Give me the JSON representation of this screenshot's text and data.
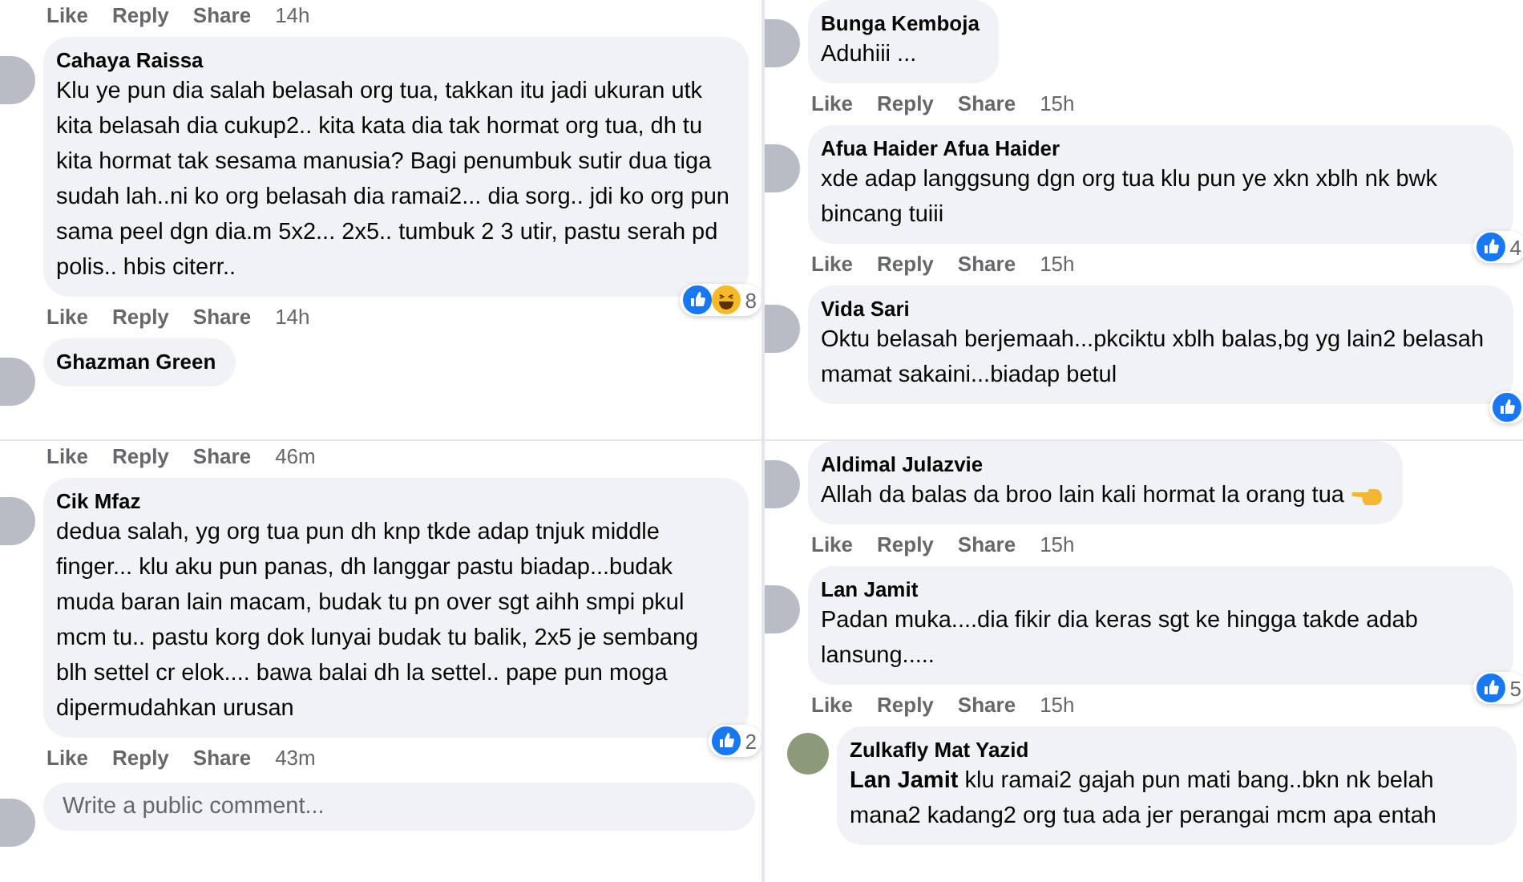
{
  "panels": [
    {
      "items": [
        {
          "kind": "actions",
          "like": "Like",
          "reply": "Reply",
          "share": "Share",
          "time": "14h"
        },
        {
          "kind": "comment",
          "name": "Cahaya Raissa",
          "text": "Klu ye pun dia salah belasah org tua, takkan itu jadi ukuran utk kita belasah dia cukup2.. kita kata dia tak hormat org tua, dh tu kita hormat tak sesama manusia? Bagi penumbuk sutir dua tiga sudah lah..ni ko org belasah dia ramai2... dia sorg.. jdi ko org pun sama peel dgn dia.m 5x2... 2x5.. tumbuk 2 3 utir, pastu serah pd polis.. hbis citerr..",
          "reactions": {
            "icons": [
              {
                "kind": "like"
              },
              {
                "kind": "haha"
              }
            ],
            "count": "8"
          }
        },
        {
          "kind": "actions",
          "like": "Like",
          "reply": "Reply",
          "share": "Share",
          "time": "14h"
        },
        {
          "kind": "comment",
          "name": "Ghazman Green"
        }
      ]
    },
    {
      "items": [
        {
          "kind": "actions",
          "like": "Like",
          "reply": "Reply",
          "share": "Share",
          "time": "46m"
        },
        {
          "kind": "comment",
          "name": "Cik Mfaz",
          "text": "dedua salah, yg org tua pun dh knp tkde adap tnjuk middle finger... klu aku pun panas, dh langgar pastu biadap...budak muda baran lain macam, budak tu pn over sgt aihh smpi pkul mcm tu.. pastu korg dok lunyai budak tu balik, 2x5 je sembang blh settel cr elok.... bawa balai dh la settel.. pape pun moga dipermudahkan urusan",
          "reactions": {
            "icons": [
              {
                "kind": "like"
              }
            ],
            "count": "2"
          }
        },
        {
          "kind": "actions",
          "like": "Like",
          "reply": "Reply",
          "share": "Share",
          "time": "43m"
        },
        {
          "kind": "composer",
          "placeholder": "Write a public comment..."
        }
      ]
    },
    {
      "items": [
        {
          "kind": "comment",
          "name": "Bunga Kemboja",
          "text": "Aduhiii ..."
        },
        {
          "kind": "actions",
          "like": "Like",
          "reply": "Reply",
          "share": "Share",
          "time": "15h"
        },
        {
          "kind": "comment",
          "name": "Afua Haider Afua Haider",
          "text": "xde adap langgsung dgn org tua klu pun ye xkn xblh nk bwk bincang tuiii",
          "reactions": {
            "icons": [
              {
                "kind": "like"
              }
            ],
            "count": "4"
          }
        },
        {
          "kind": "actions",
          "like": "Like",
          "reply": "Reply",
          "share": "Share",
          "time": "15h"
        },
        {
          "kind": "comment",
          "name": "Vida Sari",
          "text": "Oktu belasah berjemaah...pkciktu xblh balas,bg yg lain2 belasah mamat sakaini...biadap betul",
          "reactions": {
            "icons": [
              {
                "kind": "like"
              }
            ]
          }
        }
      ]
    },
    {
      "items": [
        {
          "kind": "comment",
          "name": "Aldimal Julazvie",
          "text": "Allah da balas da broo lain kali hormat la orang tua",
          "pointing_hand": true
        },
        {
          "kind": "actions",
          "like": "Like",
          "reply": "Reply",
          "share": "Share",
          "time": "15h"
        },
        {
          "kind": "comment",
          "name": "Lan Jamit",
          "text": "Padan muka....dia fikir dia keras sgt ke hingga takde adab lansung.....",
          "reactions": {
            "icons": [
              {
                "kind": "like"
              }
            ],
            "count": "5"
          }
        },
        {
          "kind": "actions",
          "like": "Like",
          "reply": "Reply",
          "share": "Share",
          "time": "15h"
        },
        {
          "kind": "reply",
          "name": "Zulkafly Mat Yazid",
          "text": "**Lan Jamit** klu ramai2 gajah pun mati bang..bkn nk belah mana2 kadang2 org tua ada jer perangai mcm apa entah"
        }
      ]
    }
  ]
}
